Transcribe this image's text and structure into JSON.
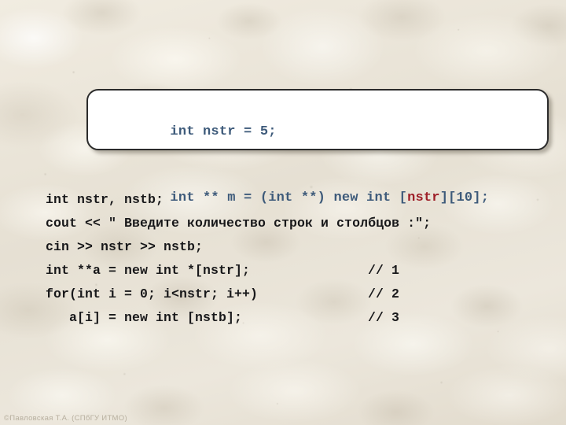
{
  "slide": {
    "background_color": "#eae5da",
    "callout": {
      "name": "code-callout-box",
      "background_color": "#ffffff",
      "border_color": "#2b2b2b",
      "text_color": "#3d5a7a",
      "highlight_color": "#9e1f28",
      "lines": [
        {
          "segments": [
            {
              "text": "int nstr = 5;",
              "style": "normal"
            }
          ]
        },
        {
          "segments": [
            {
              "text": "int ** m = (int **) new int [",
              "style": "normal"
            },
            {
              "text": "nstr",
              "style": "highlight"
            },
            {
              "text": "][10];",
              "style": "normal"
            }
          ]
        }
      ]
    },
    "code_listing": {
      "text_color": "#18181a",
      "rows": [
        {
          "code": "int nstr, nstb;",
          "comment": ""
        },
        {
          "code": "cout << \" Введите количество строк и столбцов :\";",
          "comment": ""
        },
        {
          "code": "cin >> nstr >> nstb;",
          "comment": ""
        },
        {
          "code": "int **a = new int *[nstr];",
          "comment": "// 1"
        },
        {
          "code": "for(int i = 0; i<nstr; i++)",
          "comment": "// 2"
        },
        {
          "code": "   a[i] = new int [nstb];",
          "comment": "// 3"
        }
      ]
    },
    "footer": {
      "credit": "©Павловская Т.А. (СПбГУ ИТМО)",
      "color": "#b8b0a0"
    }
  }
}
